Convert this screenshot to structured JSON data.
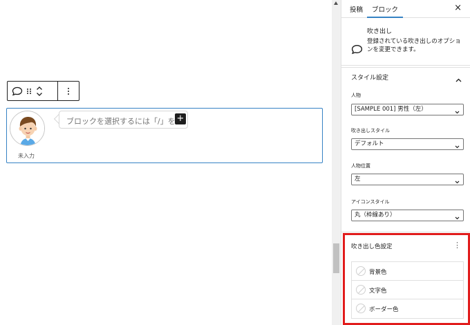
{
  "editor": {
    "placeholder": "ブロックを選択するには「/」を入力",
    "inserter_symbol": "+",
    "avatar_caption": "未入力"
  },
  "sidebar": {
    "tabs": [
      {
        "label": "投稿"
      },
      {
        "label": "ブロック"
      }
    ],
    "close_symbol": "×",
    "block": {
      "title": "吹き出し",
      "description": "登録されている吹き出しのオプションを変更できます。"
    },
    "style_panel": {
      "title": "スタイル設定",
      "fields": [
        {
          "label": "人物",
          "value": "[SAMPLE 001] 男性（左）"
        },
        {
          "label": "吹き出しスタイル",
          "value": "デフォルト"
        },
        {
          "label": "人物位置",
          "value": "左"
        },
        {
          "label": "アイコンスタイル",
          "value": "丸（枠線あり）"
        }
      ]
    },
    "color_panel": {
      "title": "吹き出し色設定",
      "options_symbol": "⋮",
      "items": [
        {
          "label": "背景色"
        },
        {
          "label": "文字色"
        },
        {
          "label": "ボーダー色"
        }
      ]
    }
  },
  "colors": {
    "accent": "#3582c4",
    "highlight": "#e11b1b"
  }
}
